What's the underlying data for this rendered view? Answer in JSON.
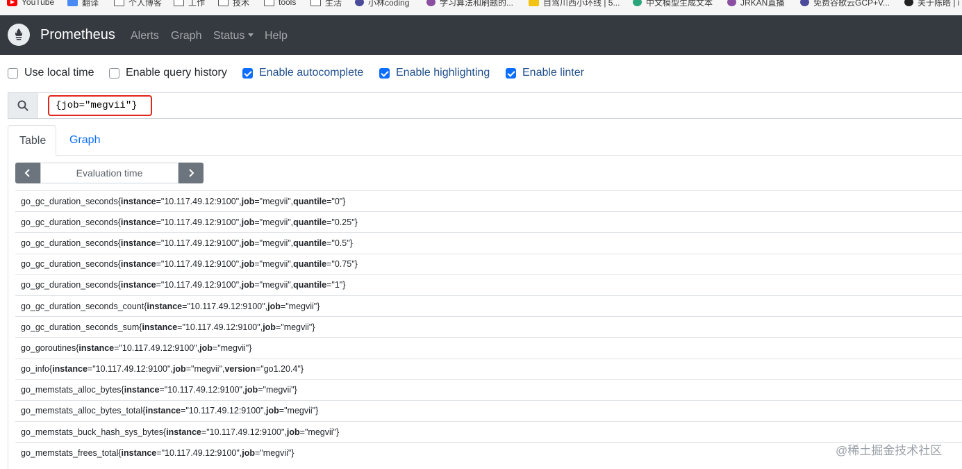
{
  "bookmarks": [
    {
      "label": "YouTube",
      "icon": "youtube-icon"
    },
    {
      "label": "翻译",
      "icon": "translate-icon"
    },
    {
      "label": "个人博客",
      "icon": "folder-icon"
    },
    {
      "label": "工作",
      "icon": "folder-icon"
    },
    {
      "label": "技术",
      "icon": "folder-icon"
    },
    {
      "label": "tools",
      "icon": "folder-icon"
    },
    {
      "label": "生活",
      "icon": "folder-icon"
    },
    {
      "label": "小林coding",
      "icon": "site-icon"
    },
    {
      "label": "学习算法和刷题的...",
      "icon": "site-icon"
    },
    {
      "label": "自驾川西小环线 | 5...",
      "icon": "site-icon"
    },
    {
      "label": "中文模型生成文本",
      "icon": "openai-icon"
    },
    {
      "label": "JRKAN直播",
      "icon": "site-icon"
    },
    {
      "label": "免费谷歌云GCP+V...",
      "icon": "site-icon"
    },
    {
      "label": "关于陈皓 | i",
      "icon": "site-icon"
    }
  ],
  "navbar": {
    "brand": "Prometheus",
    "links": [
      "Alerts",
      "Graph",
      "Status",
      "Help"
    ]
  },
  "options": [
    {
      "label": "Use local time",
      "checked": false
    },
    {
      "label": "Enable query history",
      "checked": false
    },
    {
      "label": "Enable autocomplete",
      "checked": true
    },
    {
      "label": "Enable highlighting",
      "checked": true
    },
    {
      "label": "Enable linter",
      "checked": true
    }
  ],
  "query": {
    "value": "{job=\"megvii\"}"
  },
  "tabs": {
    "table": "Table",
    "graph": "Graph"
  },
  "eval": {
    "placeholder": "Evaluation time",
    "prev": "‹",
    "next": "›"
  },
  "results": [
    {
      "metric": "go_gc_duration_seconds",
      "labels": [
        [
          "instance",
          "10.117.49.12:9100"
        ],
        [
          "job",
          "megvii"
        ],
        [
          "quantile",
          "0"
        ]
      ]
    },
    {
      "metric": "go_gc_duration_seconds",
      "labels": [
        [
          "instance",
          "10.117.49.12:9100"
        ],
        [
          "job",
          "megvii"
        ],
        [
          "quantile",
          "0.25"
        ]
      ]
    },
    {
      "metric": "go_gc_duration_seconds",
      "labels": [
        [
          "instance",
          "10.117.49.12:9100"
        ],
        [
          "job",
          "megvii"
        ],
        [
          "quantile",
          "0.5"
        ]
      ]
    },
    {
      "metric": "go_gc_duration_seconds",
      "labels": [
        [
          "instance",
          "10.117.49.12:9100"
        ],
        [
          "job",
          "megvii"
        ],
        [
          "quantile",
          "0.75"
        ]
      ]
    },
    {
      "metric": "go_gc_duration_seconds",
      "labels": [
        [
          "instance",
          "10.117.49.12:9100"
        ],
        [
          "job",
          "megvii"
        ],
        [
          "quantile",
          "1"
        ]
      ]
    },
    {
      "metric": "go_gc_duration_seconds_count",
      "labels": [
        [
          "instance",
          "10.117.49.12:9100"
        ],
        [
          "job",
          "megvii"
        ]
      ]
    },
    {
      "metric": "go_gc_duration_seconds_sum",
      "labels": [
        [
          "instance",
          "10.117.49.12:9100"
        ],
        [
          "job",
          "megvii"
        ]
      ]
    },
    {
      "metric": "go_goroutines",
      "labels": [
        [
          "instance",
          "10.117.49.12:9100"
        ],
        [
          "job",
          "megvii"
        ]
      ]
    },
    {
      "metric": "go_info",
      "labels": [
        [
          "instance",
          "10.117.49.12:9100"
        ],
        [
          "job",
          "megvii"
        ],
        [
          "version",
          "go1.20.4"
        ]
      ]
    },
    {
      "metric": "go_memstats_alloc_bytes",
      "labels": [
        [
          "instance",
          "10.117.49.12:9100"
        ],
        [
          "job",
          "megvii"
        ]
      ]
    },
    {
      "metric": "go_memstats_alloc_bytes_total",
      "labels": [
        [
          "instance",
          "10.117.49.12:9100"
        ],
        [
          "job",
          "megvii"
        ]
      ]
    },
    {
      "metric": "go_memstats_buck_hash_sys_bytes",
      "labels": [
        [
          "instance",
          "10.117.49.12:9100"
        ],
        [
          "job",
          "megvii"
        ]
      ]
    },
    {
      "metric": "go_memstats_frees_total",
      "labels": [
        [
          "instance",
          "10.117.49.12:9100"
        ],
        [
          "job",
          "megvii"
        ]
      ]
    }
  ],
  "watermark": "@稀土掘金技术社区",
  "colors": {
    "navbar": "#343a40",
    "accent": "#0d6efd",
    "highlight_border": "#e0261b"
  }
}
